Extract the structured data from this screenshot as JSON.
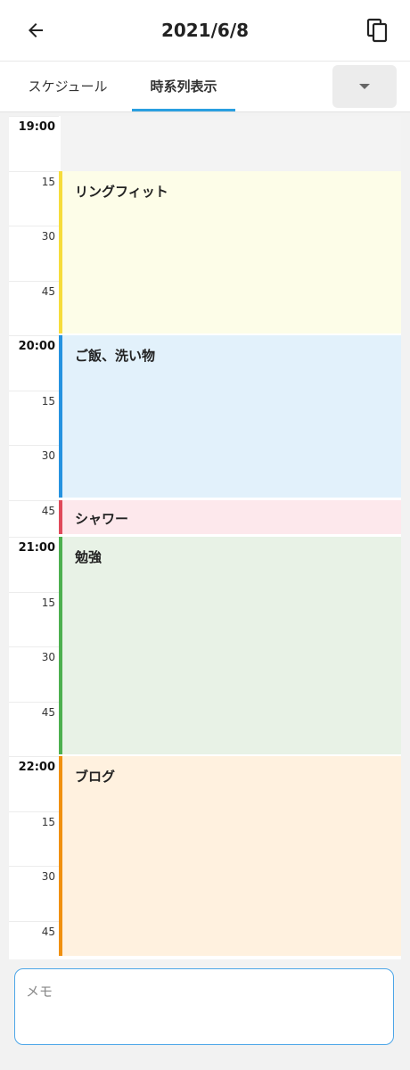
{
  "appbar": {
    "title": "2021/6/8",
    "back_icon": "arrow-left-icon",
    "copy_icon": "copy-icon"
  },
  "tabs": [
    {
      "label": "スケジュール",
      "selected": false
    },
    {
      "label": "時系列表示",
      "selected": true
    }
  ],
  "timeline": {
    "labels": [
      "19:00",
      "15",
      "30",
      "45",
      "20:00",
      "15",
      "30",
      "45",
      "21:00",
      "15",
      "30",
      "45",
      "22:00",
      "15",
      "30",
      "45"
    ],
    "events": [
      {
        "title": "リングフィット",
        "color": "#f6dc3c"
      },
      {
        "title": "ご飯、洗い物",
        "color": "#2693e0"
      },
      {
        "title": "シャワー",
        "color": "#e04a5a"
      },
      {
        "title": "勉強",
        "color": "#4db04f"
      },
      {
        "title": "ブログ",
        "color": "#f09010"
      }
    ]
  },
  "memo": {
    "placeholder": "メモ",
    "value": ""
  },
  "colors": {
    "accent": "#2a9fe0"
  }
}
